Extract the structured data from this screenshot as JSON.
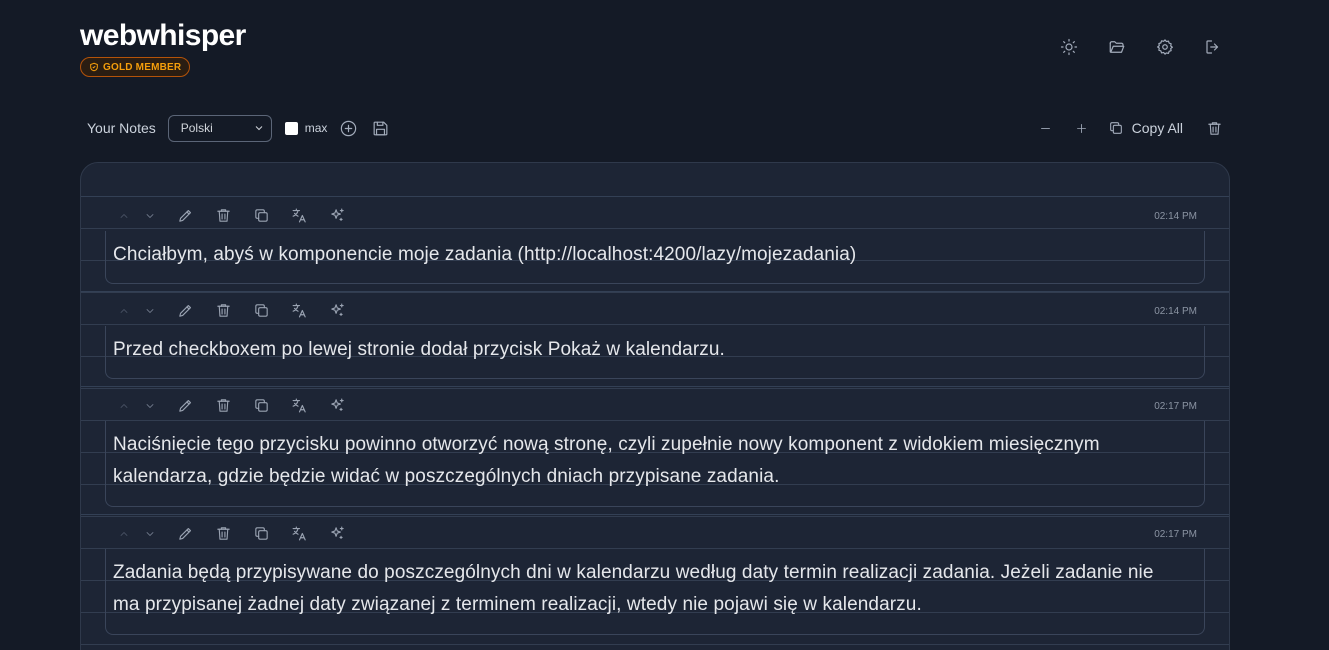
{
  "app": {
    "title": "webwhisper",
    "badge": "GOLD MEMBER"
  },
  "header_icons": [
    "sun-icon",
    "folder-open-icon",
    "gear-icon",
    "logout-icon"
  ],
  "toolbar": {
    "label": "Your Notes",
    "language": "Polski",
    "max_label": "max",
    "copy_all": "Copy All"
  },
  "notes": [
    {
      "time": "02:14 PM",
      "text": "Chciałbym, abyś w komponencie moje zadania (http://localhost:4200/lazy/mojezadania)"
    },
    {
      "time": "02:14 PM",
      "text": "Przed checkboxem po lewej stronie dodał przycisk Pokaż w kalendarzu."
    },
    {
      "time": "02:17 PM",
      "text": "Naciśnięcie tego przycisku powinno otworzyć nową stronę, czyli zupełnie nowy komponent z widokiem miesięcznym kalendarza, gdzie będzie widać w poszczególnych dniach przypisane zadania."
    },
    {
      "time": "02:17 PM",
      "text": "Zadania będą przypisywane do poszczególnych dni w kalendarzu według daty termin realizacji zadania. Jeżeli zadanie nie ma przypisanej żadnej daty związanej z terminem realizacji, wtedy nie pojawi się w kalendarzu."
    }
  ],
  "colors": {
    "background": "#141a26",
    "panel": "#1d2535",
    "badge_accent": "#f59e0b"
  }
}
